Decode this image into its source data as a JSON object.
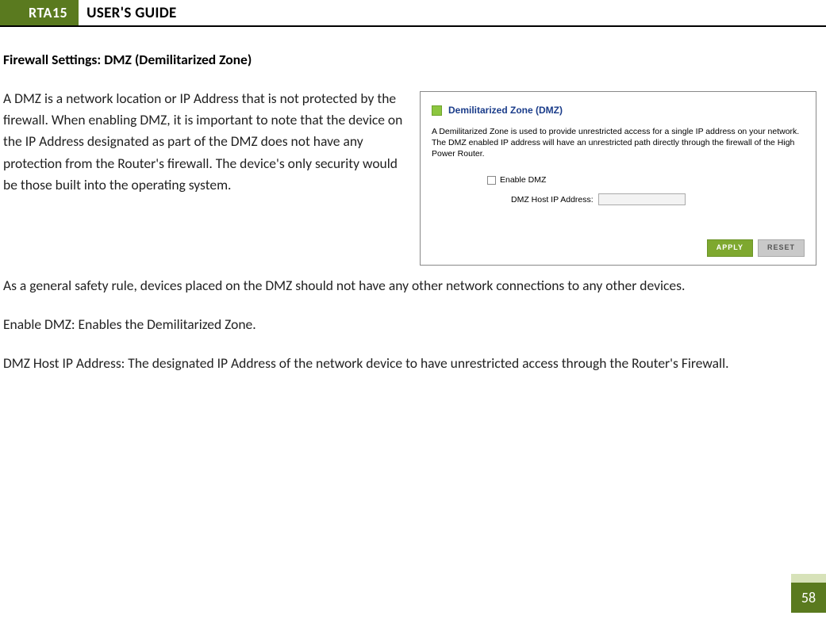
{
  "header": {
    "badge": "RTA15",
    "title": "USER'S GUIDE"
  },
  "section_heading": "Firewall Settings: DMZ (Demilitarized Zone)",
  "para1": "A DMZ is a network location or IP Address that is not protected by the firewall.  When enabling DMZ, it is important to note that the device on the IP Address designated as part of the DMZ does not have any protection from the Router's firewall.  The device's only security would be those built into the operating system.",
  "para2": "As a general safety rule, devices placed on the DMZ should not have any other network connections to any other devices.",
  "para3": "Enable DMZ: Enables the Demilitarized Zone.",
  "para4": "DMZ Host IP Address:  The designated IP Address of the network device to have unrestricted access through the Router's Firewall.",
  "screenshot": {
    "title": "Demilitarized Zone (DMZ)",
    "description": "A Demilitarized Zone is used to provide unrestricted access for a single IP address on your network. The DMZ enabled IP address will have an unrestricted path directly through the firewall of the High Power Router.",
    "checkbox_label": "Enable DMZ",
    "ip_label": "DMZ Host IP Address:",
    "apply": "APPLY",
    "reset": "RESET"
  },
  "page_number": "58"
}
